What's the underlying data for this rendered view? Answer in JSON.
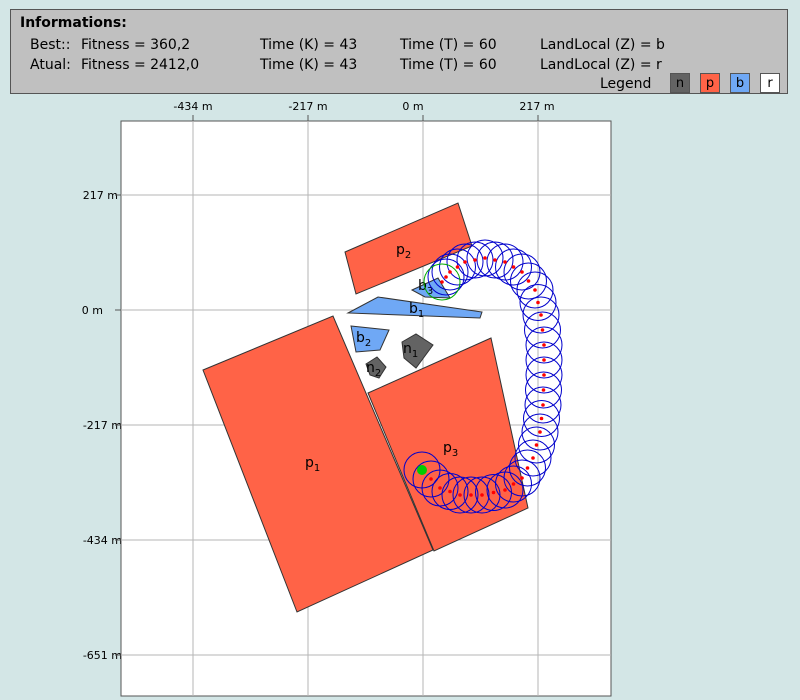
{
  "info": {
    "title": "Informations:",
    "best": {
      "label": "Best::",
      "fitness": "Fitness = 360,2",
      "time_k": "Time (K) = 43",
      "time_t": "Time (T) = 60",
      "landlocal": "LandLocal (Z) = b"
    },
    "atual": {
      "label": "Atual:",
      "fitness": "Fitness = 2412,0",
      "time_k": "Time (K) = 43",
      "time_t": "Time (T) = 60",
      "landlocal": "LandLocal (Z) = r"
    },
    "legend": {
      "label": "Legend",
      "items": [
        {
          "key": "n",
          "color": "#636363",
          "text_color": "#000000"
        },
        {
          "key": "p",
          "color": "#ff6347",
          "text_color": "#000000"
        },
        {
          "key": "b",
          "color": "#6fa8f5",
          "text_color": "#000000"
        },
        {
          "key": "r",
          "color": "#ffffff",
          "text_color": "#000000"
        }
      ]
    }
  },
  "map": {
    "x_ticks": [
      "-434 m",
      "-217 m",
      "0 m",
      "217 m"
    ],
    "y_ticks": [
      "217 m",
      "0 m",
      "-217 m",
      "-434 m",
      "-651 m"
    ],
    "regions": [
      {
        "id": "p1",
        "type": "p",
        "base": "p",
        "sub": "1"
      },
      {
        "id": "p2",
        "type": "p",
        "base": "p",
        "sub": "2"
      },
      {
        "id": "p3",
        "type": "p",
        "base": "p",
        "sub": "3"
      },
      {
        "id": "b1",
        "type": "b",
        "base": "b",
        "sub": "1"
      },
      {
        "id": "b2",
        "type": "b",
        "base": "b",
        "sub": "2"
      },
      {
        "id": "b3",
        "type": "b",
        "base": "b",
        "sub": "3"
      },
      {
        "id": "n1",
        "type": "n",
        "base": "n",
        "sub": "1"
      },
      {
        "id": "n2",
        "type": "n",
        "base": "n",
        "sub": "2"
      }
    ],
    "trajectory": {
      "circle_color": "#0000cc",
      "dot_color": "#ff0000",
      "start_color": "#00cc00",
      "end_color": "#00aa00"
    }
  }
}
